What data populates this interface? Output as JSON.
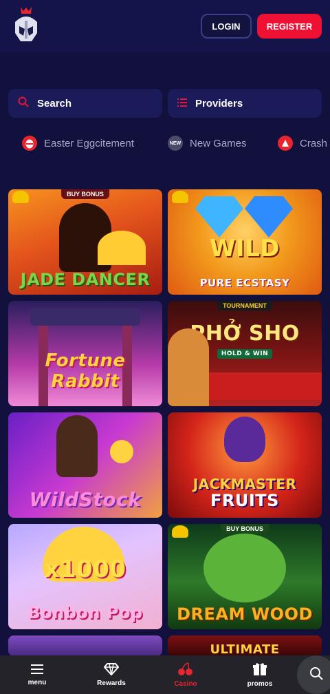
{
  "header": {
    "login_label": "LOGIN",
    "register_label": "REGISTER"
  },
  "search": {
    "search_label": "Search",
    "providers_label": "Providers"
  },
  "categories": [
    {
      "label": "Easter Eggcitement",
      "icon": "easter-egg-icon"
    },
    {
      "label": "New Games",
      "icon": "new-badge-icon"
    },
    {
      "label": "Crash",
      "icon": "crash-icon"
    }
  ],
  "games": [
    {
      "title": "JADE DANCER",
      "badge": "BUY BONUS"
    },
    {
      "title": "WILD",
      "subtitle": "PURE ECSTASY"
    },
    {
      "title": "Fortune Rabbit"
    },
    {
      "title": "PHỞ SHO",
      "badge": "TOURNAMENT",
      "subtitle": "HOLD & WIN"
    },
    {
      "title": "WildStock"
    },
    {
      "title": "JACKMASTER",
      "subtitle": "FRUITS"
    },
    {
      "title": "x1000",
      "subtitle": "Bonbon Pop"
    },
    {
      "title": "DREAM WOOD",
      "badge": "BUY BONUS"
    },
    {
      "title": ""
    },
    {
      "title": "ULTIMATE"
    }
  ],
  "nav": {
    "menu": "menu",
    "rewards": "Rewards",
    "casino": "Casino",
    "promos": "promos"
  },
  "colors": {
    "background": "#12113d",
    "accent": "#ee1133",
    "pill": "#1c1b5a"
  }
}
